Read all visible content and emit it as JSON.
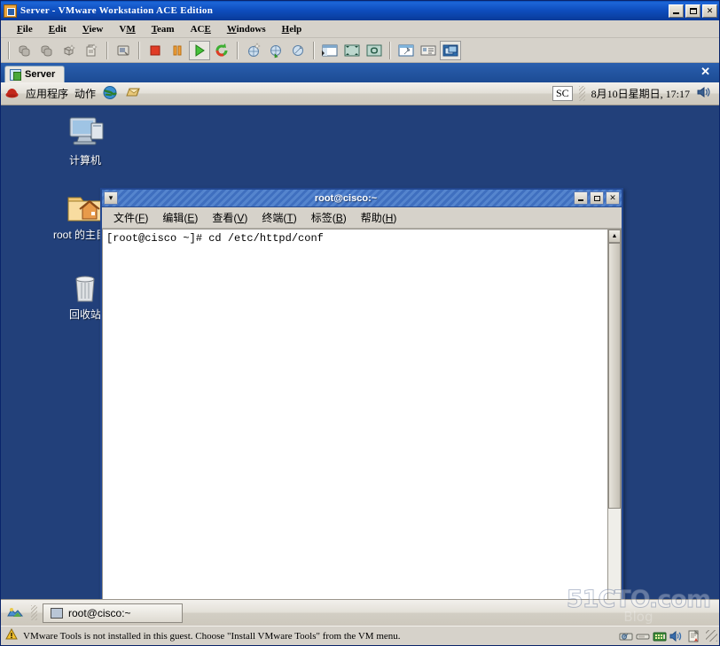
{
  "vmware": {
    "title": "Server - VMware Workstation ACE Edition",
    "title_icon": "vmware-app-icon",
    "window_buttons": [
      {
        "name": "minimize-button",
        "label": "_"
      },
      {
        "name": "maximize-button",
        "label": "□"
      },
      {
        "name": "close-button",
        "label": "✕"
      }
    ],
    "menus": [
      {
        "label": "File",
        "accel": "F"
      },
      {
        "label": "Edit",
        "accel": "E"
      },
      {
        "label": "View",
        "accel": "V"
      },
      {
        "label": "VM",
        "accel": "M"
      },
      {
        "label": "Team",
        "accel": "T"
      },
      {
        "label": "ACE",
        "accel": "E"
      },
      {
        "label": "Windows",
        "accel": "W"
      },
      {
        "label": "Help",
        "accel": "H"
      }
    ],
    "toolbar": [
      {
        "name": "snapshot-icon",
        "group": 1
      },
      {
        "name": "revert-snapshot-icon",
        "group": 1
      },
      {
        "name": "manage-snapshots-icon",
        "group": 1
      },
      {
        "name": "snapshot-manager-icon",
        "group": 1
      },
      {
        "name": "capture-screen-icon",
        "group": 2
      },
      {
        "name": "power-off-icon",
        "group": 3
      },
      {
        "name": "suspend-icon",
        "group": 3
      },
      {
        "name": "power-on-icon",
        "group": 3,
        "selected": true
      },
      {
        "name": "reset-icon",
        "group": 3
      },
      {
        "name": "new-virtual-machine-icon",
        "group": 4
      },
      {
        "name": "clone-virtual-machine-icon",
        "group": 4
      },
      {
        "name": "vm-settings-icon",
        "group": 4
      },
      {
        "name": "show-sidebar-icon",
        "group": 5
      },
      {
        "name": "fullscreen-icon",
        "group": 5
      },
      {
        "name": "quick-switch-icon",
        "group": 5
      },
      {
        "name": "edit-vm-settings-icon",
        "group": 6
      },
      {
        "name": "summary-view-icon",
        "group": 6
      },
      {
        "name": "console-view-icon",
        "group": 6,
        "selected": true
      }
    ],
    "tab": {
      "label": "Server",
      "icon": "virtual-machine-icon",
      "close_label": "✕"
    },
    "statusbar": {
      "message": "VMware Tools is not installed in this guest. Choose \"Install VMware Tools\" from the VM menu.",
      "warning_icon": "warning-triangle-icon",
      "devices": [
        {
          "name": "hard-disk-icon"
        },
        {
          "name": "floppy-drive-icon"
        },
        {
          "name": "network-adapter-icon"
        },
        {
          "name": "sound-card-icon"
        },
        {
          "name": "printer-icon"
        }
      ]
    }
  },
  "guest": {
    "top_panel": {
      "menu_icon": "redhat-icon",
      "applications_label": "应用程序",
      "actions_label": "动作",
      "launchers": [
        {
          "name": "web-browser-icon"
        },
        {
          "name": "evolution-mail-icon"
        }
      ],
      "input_method": "SC",
      "clock": "8月10日星期日, 17:17",
      "volume_icon": "speaker-icon"
    },
    "desktop": {
      "background_color": "#22407a",
      "icons": [
        {
          "name": "desktop-icon-computer",
          "label": "计算机",
          "glyph": "computer-icon"
        },
        {
          "name": "desktop-icon-home",
          "label": "root 的主目录",
          "glyph": "home-folder-icon"
        },
        {
          "name": "desktop-icon-trash",
          "label": "回收站",
          "glyph": "trash-icon"
        }
      ]
    },
    "terminal": {
      "title": "root@cisco:~",
      "window_menu_icon": "window-menu-chevron-icon",
      "buttons": [
        {
          "name": "terminal-minimize-button"
        },
        {
          "name": "terminal-maximize-button"
        },
        {
          "name": "terminal-close-button",
          "label": "✕"
        }
      ],
      "menus": [
        {
          "label": "文件",
          "accel": "F"
        },
        {
          "label": "编辑",
          "accel": "E"
        },
        {
          "label": "查看",
          "accel": "V"
        },
        {
          "label": "终端",
          "accel": "T"
        },
        {
          "label": "标签",
          "accel": "B"
        },
        {
          "label": "帮助",
          "accel": "H"
        }
      ],
      "content": "[root@cisco ~]# cd /etc/httpd/conf",
      "scrollbar": {
        "up_arrow": "▲",
        "down_arrow": "▼"
      }
    },
    "bottom_panel": {
      "show_desktop_icon": "show-desktop-icon",
      "tasks": [
        {
          "name": "taskbar-item-terminal",
          "label": "root@cisco:~",
          "icon": "terminal-window-icon"
        }
      ]
    }
  },
  "watermark": {
    "main": "51CTO.com",
    "sub": "Blog"
  }
}
